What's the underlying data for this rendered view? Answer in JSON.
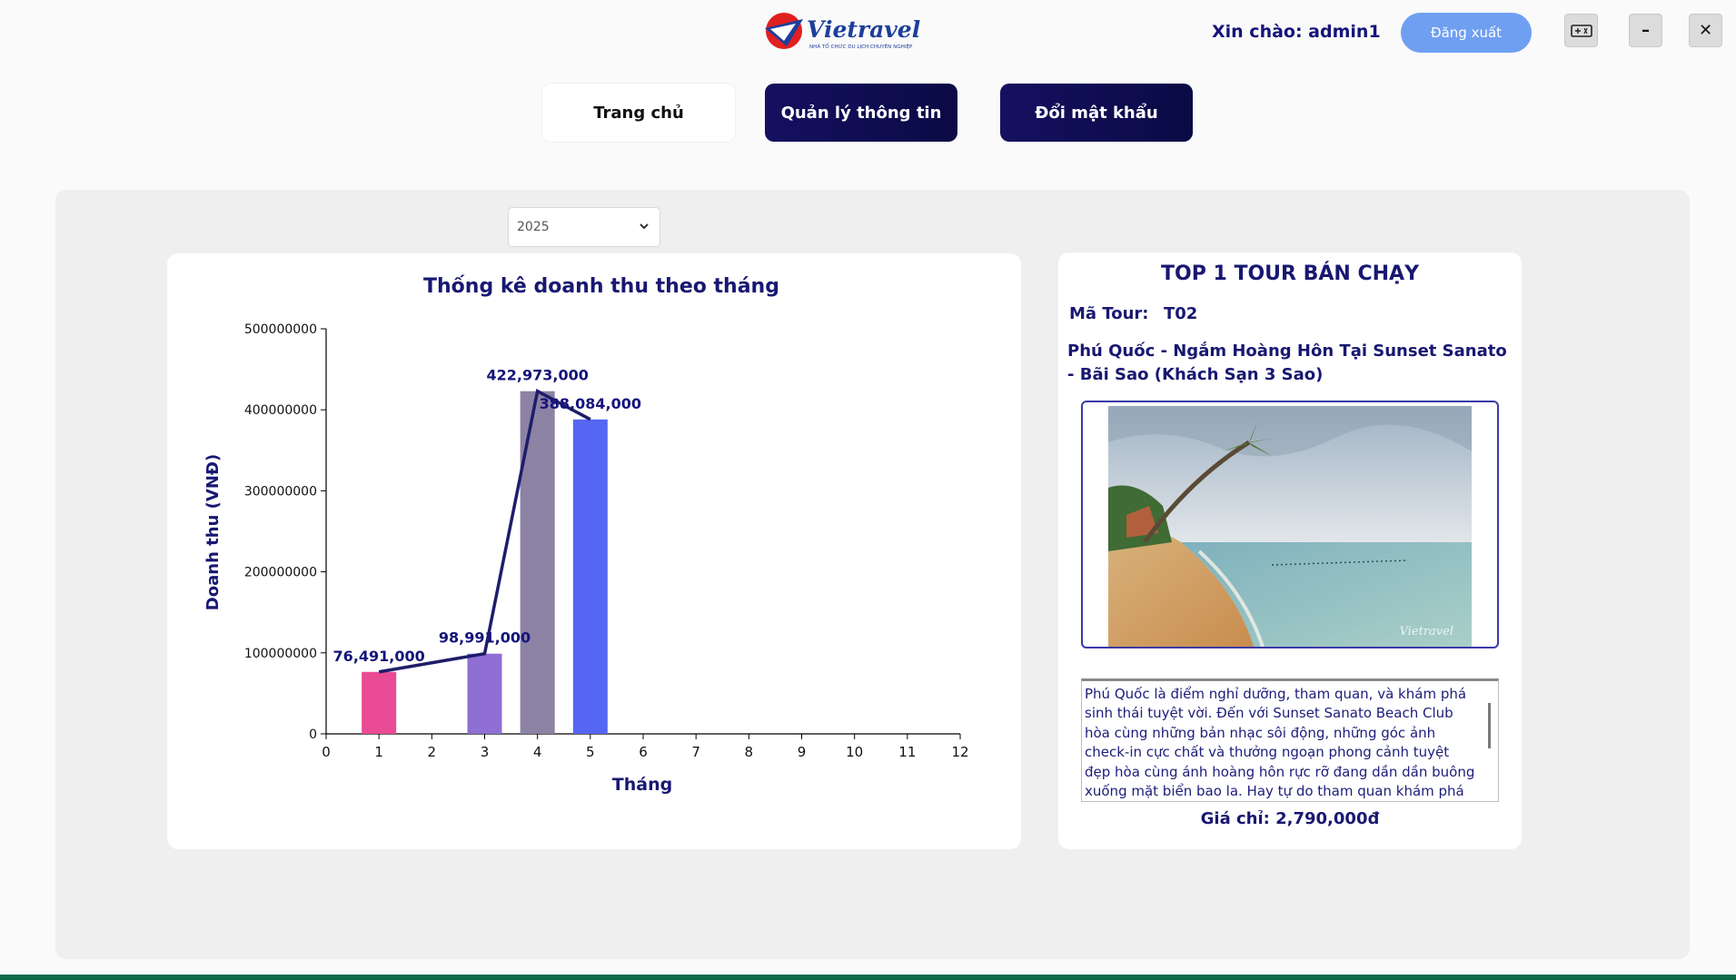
{
  "header": {
    "logo_text": "Vietravel",
    "logo_tagline": "NHÀ TỔ CHỨC DU LỊCH CHUYÊN NGHIỆP",
    "greeting": "Xin chào: admin1",
    "logout_label": "Đăng xuất",
    "window_minimize": "–",
    "window_close": "✕"
  },
  "nav": {
    "home": "Trang chủ",
    "manage_info": "Quản lý thông tin",
    "change_password": "Đổi mật khẩu"
  },
  "filter": {
    "year": "2025"
  },
  "colors": {
    "navy": "#181872",
    "bar_month_1": "#e94b95",
    "bar_month_3": "#8f6fd3",
    "bar_month_4": "#8c82a4",
    "bar_month_5": "#5566f2",
    "line": "#1d1d6b"
  },
  "chart_data": {
    "type": "bar",
    "title": "Thống kê doanh thu theo tháng",
    "xlabel": "Tháng",
    "ylabel": "Doanh thu (VNĐ)",
    "x_ticks": [
      0,
      1,
      2,
      3,
      4,
      5,
      6,
      7,
      8,
      9,
      10,
      11,
      12
    ],
    "y_ticks": [
      "0",
      "100000000",
      "200000000",
      "300000000",
      "400000000",
      "500000000"
    ],
    "xlim": [
      0,
      12
    ],
    "ylim": [
      0,
      500000000
    ],
    "grid": false,
    "bars": [
      {
        "month": 1,
        "value": 76491000,
        "label": "76,491,000"
      },
      {
        "month": 3,
        "value": 98991000,
        "label": "98,991,000"
      },
      {
        "month": 4,
        "value": 422973000,
        "label": "422,973,000"
      },
      {
        "month": 5,
        "value": 388084000,
        "label": "388,084,000"
      }
    ],
    "line_overlay": true
  },
  "top_tour": {
    "heading": "TOP 1 TOUR BÁN CHẠY",
    "code_label": "Mã Tour:",
    "code": "T02",
    "name": "Phú Quốc - Ngắm Hoàng Hôn Tại Sunset Sanato - Bãi Sao (Khách Sạn 3 Sao)",
    "image_watermark": "Vietravel",
    "description": "Phú Quốc là điểm nghỉ dưỡng, tham quan, và khám phá sinh thái tuyệt vời. Đến với Sunset Sanato Beach Club hòa cùng những bản nhạc sôi động, những góc ảnh check-in cực chất và thưởng ngoạn phong cảnh tuyệt đẹp hòa cùng ánh hoàng hôn rực rỡ đang dần dần buông xuống mặt biển bao la. Hay tự do tham quan khám phá Khu vui chơi",
    "price": "Giá chỉ: 2,790,000đ"
  }
}
